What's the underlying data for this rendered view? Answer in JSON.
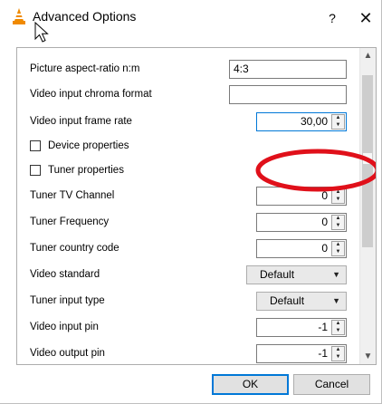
{
  "window": {
    "title": "Advanced Options",
    "help_label": "?",
    "close_label": "✕"
  },
  "options": {
    "aspect_ratio": {
      "label": "Picture aspect-ratio n:m",
      "value": "4:3"
    },
    "chroma_format": {
      "label": "Video input chroma format",
      "value": ""
    },
    "frame_rate": {
      "label": "Video input frame rate",
      "value": "30,00"
    },
    "device_properties": {
      "label": "Device properties",
      "checked": false
    },
    "tuner_properties": {
      "label": "Tuner properties",
      "checked": false
    },
    "tuner_tv_channel": {
      "label": "Tuner TV Channel",
      "value": "0"
    },
    "tuner_frequency": {
      "label": "Tuner Frequency",
      "value": "0"
    },
    "tuner_country_code": {
      "label": "Tuner country code",
      "value": "0"
    },
    "video_standard": {
      "label": "Video standard",
      "value": "Default"
    },
    "tuner_input_type": {
      "label": "Tuner input type",
      "value": "Default"
    },
    "video_input_pin": {
      "label": "Video input pin",
      "value": "-1"
    },
    "video_output_pin": {
      "label": "Video output pin",
      "value": "-1"
    }
  },
  "buttons": {
    "ok": "OK",
    "cancel": "Cancel"
  },
  "colors": {
    "highlight": "#e0101a",
    "focus": "#0078d7"
  }
}
